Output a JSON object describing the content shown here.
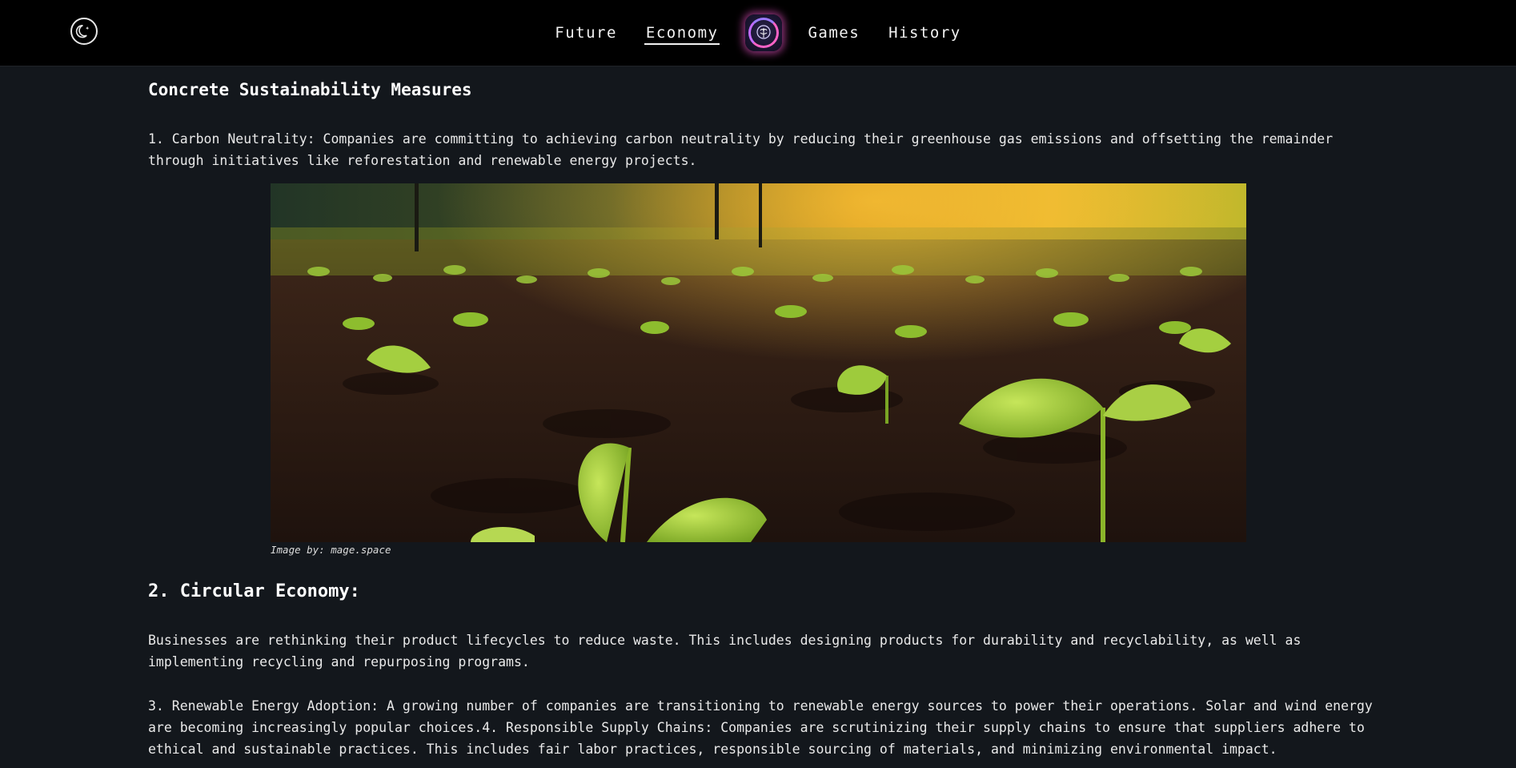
{
  "nav": {
    "items": [
      {
        "label": "Future",
        "active": false
      },
      {
        "label": "Economy",
        "active": true
      },
      {
        "label": "Games",
        "active": false
      },
      {
        "label": "History",
        "active": false
      }
    ],
    "logo_icon": "brain-logo-icon",
    "theme_toggle_icon": "moon-star-icon"
  },
  "article": {
    "heading": "Concrete Sustainability Measures",
    "carbon_paragraph": "1. Carbon Neutrality: Companies are committing to achieving carbon neutrality by reducing their greenhouse gas emissions and offsetting the remainder through initiatives like reforestation and renewable energy projects.",
    "image_caption": "Image by: mage.space",
    "circular_heading": "2. Circular Economy:",
    "circular_paragraph": "Businesses are rethinking their product lifecycles to reduce waste. This includes designing products for durability and recyclability, as well as implementing recycling and repurposing programs.",
    "renewable_paragraph": "3. Renewable Energy Adoption: A growing number of companies are transitioning to renewable energy sources to power their operations. Solar and wind energy are becoming increasingly popular choices.4. Responsible Supply Chains: Companies are scrutinizing their supply chains to ensure that suppliers adhere to ethical and sustainable practices. This includes fair labor practices, responsible sourcing of materials, and minimizing environmental impact."
  },
  "colors": {
    "page_bg": "#13171c",
    "header_bg": "#000000",
    "logo_glow": "#e150be"
  }
}
